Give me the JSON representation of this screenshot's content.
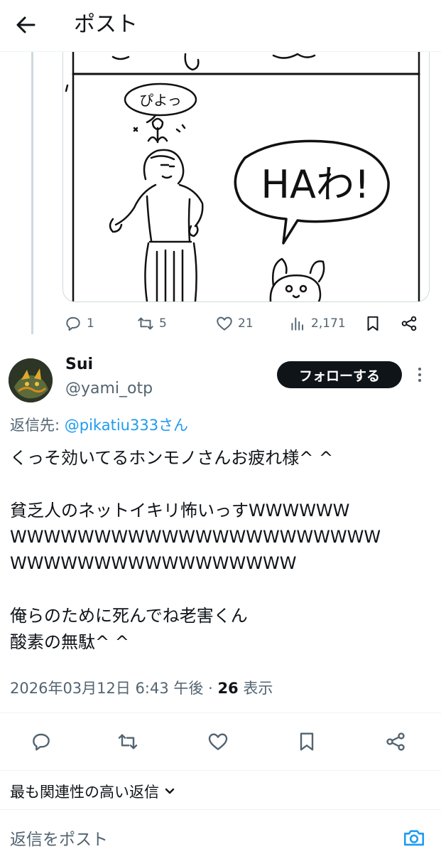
{
  "header": {
    "title": "ポスト"
  },
  "media": {
    "bubble_small": "ぴよっ",
    "bubble_large": "HAわ!"
  },
  "parent_actions": {
    "reply_count": "1",
    "repost_count": "5",
    "like_count": "21",
    "view_count": "2,171"
  },
  "author": {
    "name": "Sui",
    "handle": "@yami_otp",
    "follow_label": "フォローする"
  },
  "reply_to": {
    "prefix": "返信先: ",
    "mention": "@pikatiu333さん"
  },
  "post": {
    "text": "くっそ効いてるホンモノさんお疲れ様^ ^\n\n貧乏人のネットイキリ怖いっすWWWWWW\nWWWWWWWWWWWWWWWWWWWWWW\nWWWWWWWWWWWWWWWWW\n\n俺らのために死んでね老害くん\n酸素の無駄^ ^"
  },
  "meta": {
    "timestamp": "2026年03月12日 6:43 午後",
    "separator": " · ",
    "views": "26",
    "views_label": " 表示"
  },
  "replies": {
    "sort_label": "最も関連性の高い返信"
  },
  "compose": {
    "placeholder": "返信をポスト"
  },
  "icons": {
    "back": "arrow-left-icon",
    "reply": "reply-icon",
    "repost": "repost-icon",
    "like": "heart-icon",
    "views": "views-icon",
    "bookmark": "bookmark-icon",
    "share": "share-icon",
    "more": "more-vertical-icon",
    "chevron": "chevron-down-icon",
    "camera": "camera-icon"
  },
  "colors": {
    "link": "#1d9bf0",
    "secondary_text": "#536471",
    "primary_text": "#0f1419",
    "follow_button": "#0f1419"
  }
}
